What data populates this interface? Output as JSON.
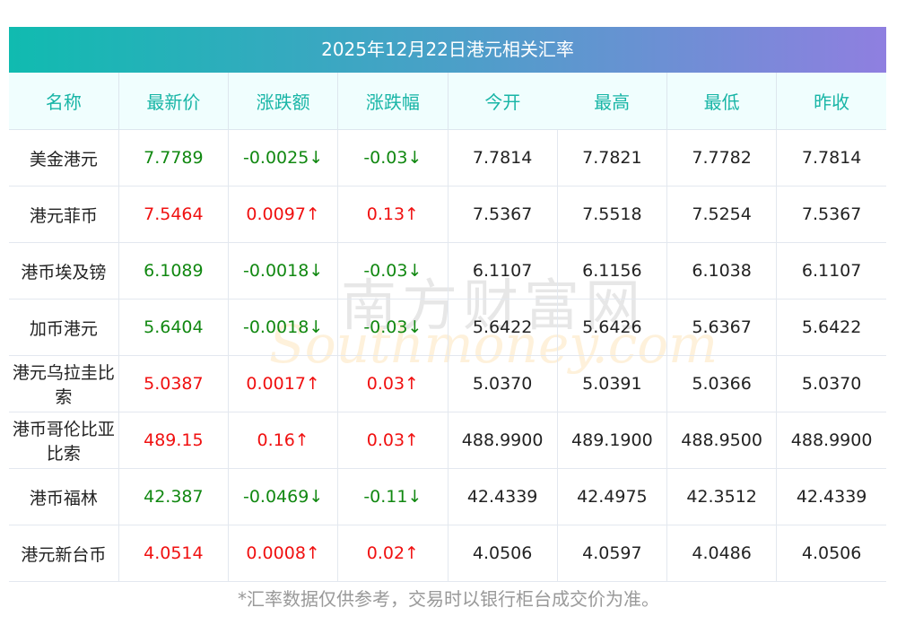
{
  "title": "2025年12月22日港元相关汇率",
  "headers": [
    "名称",
    "最新价",
    "涨跌额",
    "涨跌幅",
    "今开",
    "最高",
    "最低",
    "昨收"
  ],
  "rows": [
    {
      "name": "美金港元",
      "latest": "7.7789",
      "change": "-0.0025↓",
      "pct": "-0.03↓",
      "open": "7.7814",
      "high": "7.7821",
      "low": "7.7782",
      "prev": "7.7814",
      "dir": "down"
    },
    {
      "name": "港元菲币",
      "latest": "7.5464",
      "change": "0.0097↑",
      "pct": "0.13↑",
      "open": "7.5367",
      "high": "7.5518",
      "low": "7.5254",
      "prev": "7.5367",
      "dir": "up"
    },
    {
      "name": "港币埃及镑",
      "latest": "6.1089",
      "change": "-0.0018↓",
      "pct": "-0.03↓",
      "open": "6.1107",
      "high": "6.1156",
      "low": "6.1038",
      "prev": "6.1107",
      "dir": "down"
    },
    {
      "name": "加币港元",
      "latest": "5.6404",
      "change": "-0.0018↓",
      "pct": "-0.03↓",
      "open": "5.6422",
      "high": "5.6426",
      "low": "5.6367",
      "prev": "5.6422",
      "dir": "down"
    },
    {
      "name": "港元乌拉圭比索",
      "latest": "5.0387",
      "change": "0.0017↑",
      "pct": "0.03↑",
      "open": "5.0370",
      "high": "5.0391",
      "low": "5.0366",
      "prev": "5.0370",
      "dir": "up"
    },
    {
      "name": "港币哥伦比亚比索",
      "latest": "489.15",
      "change": "0.16↑",
      "pct": "0.03↑",
      "open": "488.9900",
      "high": "489.1900",
      "low": "488.9500",
      "prev": "488.9900",
      "dir": "up"
    },
    {
      "name": "港币福林",
      "latest": "42.387",
      "change": "-0.0469↓",
      "pct": "-0.11↓",
      "open": "42.4339",
      "high": "42.4975",
      "low": "42.3512",
      "prev": "42.4339",
      "dir": "down"
    },
    {
      "name": "港元新台币",
      "latest": "4.0514",
      "change": "0.0008↑",
      "pct": "0.02↑",
      "open": "4.0506",
      "high": "4.0597",
      "low": "4.0486",
      "prev": "4.0506",
      "dir": "up"
    }
  ],
  "footer": "*汇率数据仅供参考，交易时以银行柜台成交价为准。",
  "watermark": {
    "cn": "南方财富网",
    "en": "Southmoney.com"
  },
  "colors": {
    "up": "#f01010",
    "down": "#118811",
    "header_text": "#18b5a6"
  }
}
